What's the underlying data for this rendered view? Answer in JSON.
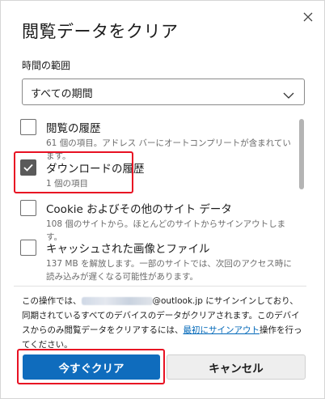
{
  "dialog": {
    "title": "閲覧データをクリア",
    "close_icon": "close-icon"
  },
  "time_range": {
    "label": "時間の範囲",
    "selected": "すべての期間"
  },
  "items": [
    {
      "title": "閲覧の履歴",
      "desc": "61 個の項目。アドレス バーにオートコンプリートが含まれています。",
      "checked": false
    },
    {
      "title": "ダウンロードの履歴",
      "desc": "1 個の項目",
      "checked": true
    },
    {
      "title": "Cookie およびその他のサイト データ",
      "desc": "108 個のサイトから。ほとんどのサイトからサインアウトします。",
      "checked": false
    },
    {
      "title": "キャッシュされた画像とファイル",
      "desc": "137 MB を解放します。一部のサイトでは、次回のアクセス時に読み込みが遅くなる可能性があります。",
      "checked": false
    }
  ],
  "info": {
    "prefix": "この操作では、",
    "email_domain": "@outlook.jp",
    "middle": " にサインインしており、同期されているすべてのデバイスのデータがクリアされます。このデバイスからのみ閲覧データをクリアするには、",
    "link": "最初にサインアウト",
    "suffix": "操作を行ってください。"
  },
  "buttons": {
    "clear_now": "今すぐクリア",
    "cancel": "キャンセル"
  },
  "colors": {
    "primary": "#0f6cbd",
    "highlight": "#e81123",
    "link": "#0067b8"
  }
}
